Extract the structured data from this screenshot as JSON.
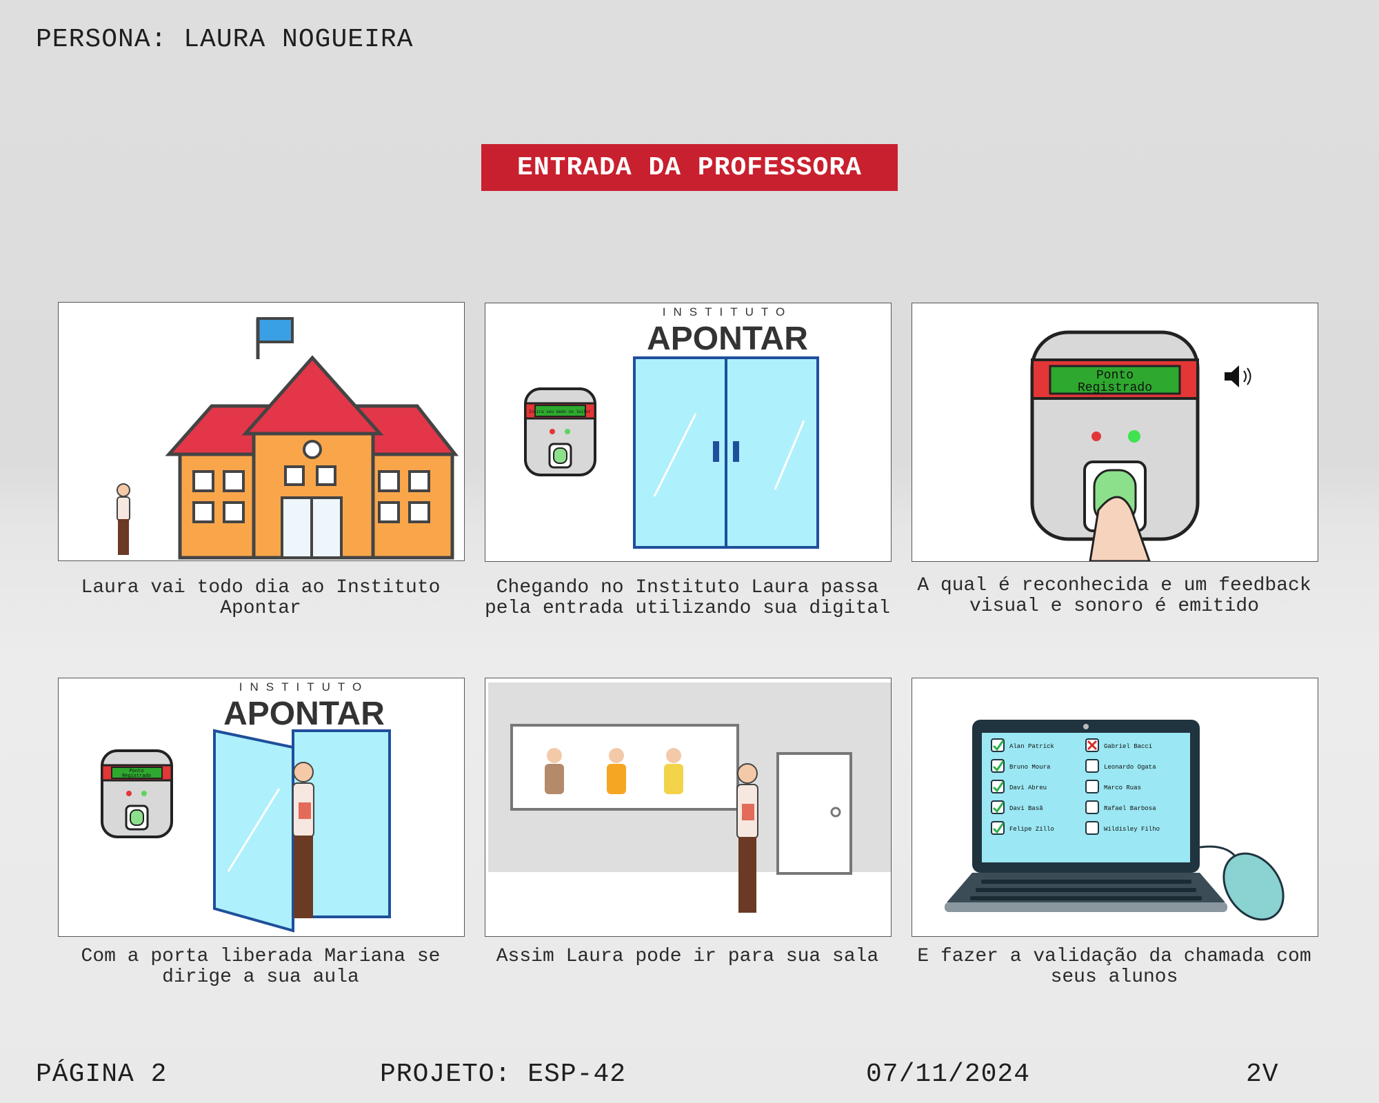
{
  "header": {
    "persona": "PERSONA: LAURA NOGUEIRA"
  },
  "title": "ENTRADA DA PROFESSORA",
  "brand": {
    "top": "INSTITUTO",
    "name": "APONTAR"
  },
  "panels": [
    {
      "caption": "Laura vai todo dia ao Instituto Apontar"
    },
    {
      "caption": "Chegando no Instituto Laura passa pela entrada utilizando sua digital",
      "device_screen": "Insira seu dedo no leitor"
    },
    {
      "caption": "A qual é reconhecida e um feedback visual e sonoro é emitido",
      "device_screen_line1": "Ponto",
      "device_screen_line2": "Registrado"
    },
    {
      "caption": "Com a porta liberada Mariana se dirige a sua aula",
      "device_screen_line1": "Ponto",
      "device_screen_line2": "Registrado"
    },
    {
      "caption": "Assim Laura pode ir para sua sala"
    },
    {
      "caption": "E fazer a validação da chamada com seus alunos",
      "students_left": [
        "Alan Patrick",
        "Bruno Moura",
        "Davi Abreu",
        "Davi Basã",
        "Felipe Zillo"
      ],
      "students_right": [
        "Gabriel Bacci",
        "Leonardo Ogata",
        "Marco Ruas",
        "Rafael Barbosa",
        "Wildisley Filho"
      ]
    }
  ],
  "footer": {
    "page": "PÁGINA 2",
    "project": "PROJETO: ESP-42",
    "date": "07/11/2024",
    "version": "2V"
  },
  "colors": {
    "accent_red": "#c8202f",
    "glass": "#aef0fb",
    "door_frame": "#1f4f9c",
    "device_body": "#d8d8d8",
    "screen_green": "#2ea82e"
  }
}
